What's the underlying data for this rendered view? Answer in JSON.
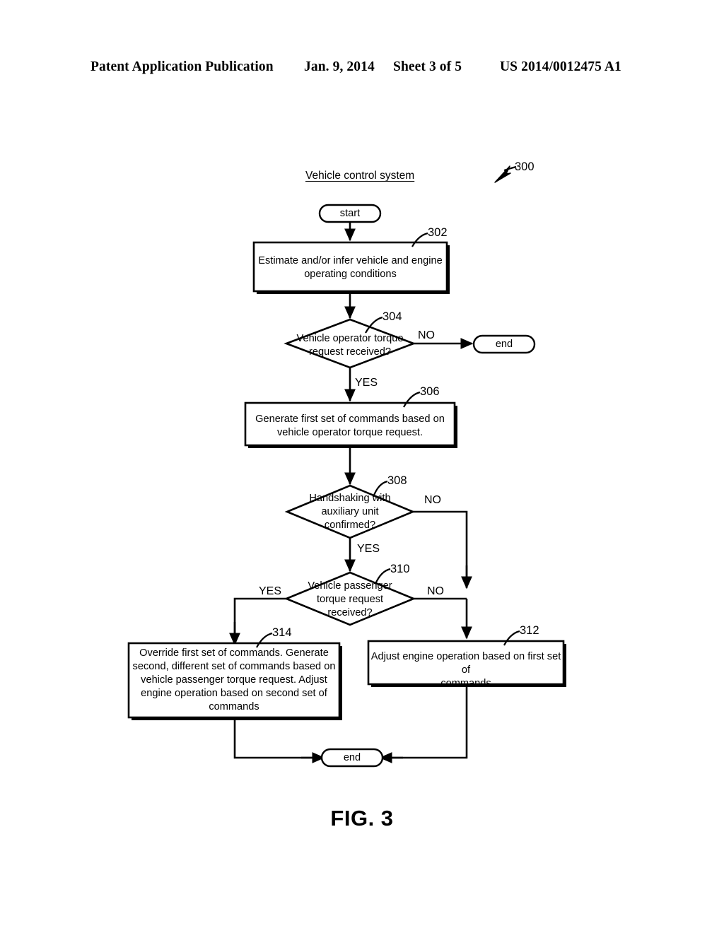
{
  "header": {
    "publication": "Patent Application Publication",
    "date": "Jan. 9, 2014",
    "sheet": "Sheet 3 of 5",
    "patent_number": "US 2014/0012475 A1"
  },
  "figure": {
    "caption": "FIG. 3",
    "diagram_title": "Vehicle control system",
    "diagram_ref": "300",
    "ink_color": "#000000",
    "background_color": "#ffffff"
  },
  "flowchart": {
    "nodes": [
      {
        "id": "start",
        "type": "terminator",
        "label": "start",
        "ref": ""
      },
      {
        "id": "302",
        "type": "process",
        "label": "Estimate and/or infer vehicle and engine\noperating conditions",
        "ref": "302"
      },
      {
        "id": "304",
        "type": "decision",
        "label": "Vehicle operator torque\nrequest received?",
        "ref": "304"
      },
      {
        "id": "end1",
        "type": "terminator",
        "label": "end",
        "ref": ""
      },
      {
        "id": "306",
        "type": "process",
        "label": "Generate first set of commands based on\nvehicle operator torque request.",
        "ref": "306"
      },
      {
        "id": "308",
        "type": "decision",
        "label": "Handshaking with\nauxiliary unit\nconfirmed?",
        "ref": "308"
      },
      {
        "id": "310",
        "type": "decision",
        "label": "Vehicle passenger\ntorque request\nreceived?",
        "ref": "310"
      },
      {
        "id": "314",
        "type": "process",
        "label": "Override first set of commands. Generate\nsecond, different set of commands based on\nvehicle passenger torque request. Adjust\nengine operation based on second set of\ncommands",
        "ref": "314"
      },
      {
        "id": "312",
        "type": "process",
        "label": "Adjust engine operation based on first set of\ncommands",
        "ref": "312"
      },
      {
        "id": "end2",
        "type": "terminator",
        "label": "end",
        "ref": ""
      }
    ],
    "edge_labels": {
      "e304_no": "NO",
      "e304_yes": "YES",
      "e308_no": "NO",
      "e308_yes": "YES",
      "e310_yes": "YES",
      "e310_no": "NO"
    }
  }
}
